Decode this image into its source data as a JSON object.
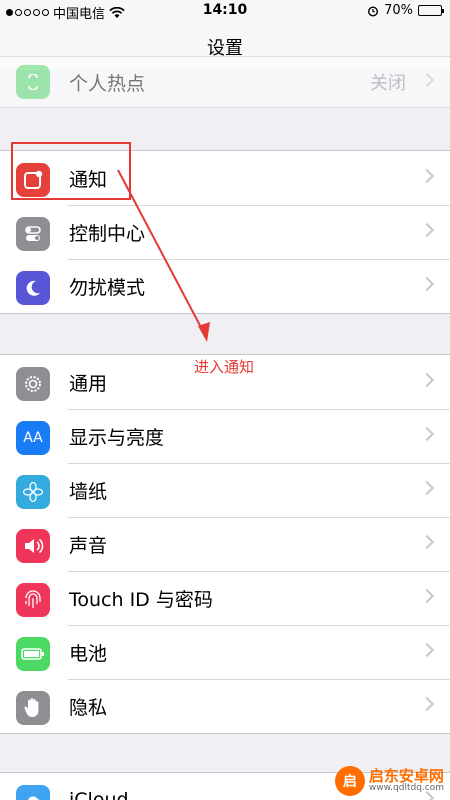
{
  "status_bar": {
    "carrier": "中国电信",
    "time": "14:10",
    "battery": "70%",
    "battery_level": 0.7
  },
  "nav": {
    "title": "设置"
  },
  "rows": {
    "hotspot": {
      "label": "个人热点",
      "value": "关闭"
    },
    "notifications": {
      "label": "通知"
    },
    "control_center": {
      "label": "控制中心"
    },
    "dnd": {
      "label": "勿扰模式"
    },
    "general": {
      "label": "通用"
    },
    "display": {
      "label": "显示与亮度",
      "icon_text": "AA"
    },
    "wallpaper": {
      "label": "墙纸"
    },
    "sounds": {
      "label": "声音"
    },
    "touchid": {
      "label": "Touch ID 与密码"
    },
    "battery": {
      "label": "电池"
    },
    "privacy": {
      "label": "隐私"
    },
    "icloud": {
      "label": "iCloud"
    }
  },
  "annotation": {
    "text": "进入通知",
    "color": "#e53935"
  },
  "watermark": {
    "name": "启东安卓网",
    "url": "www.qdltdq.com",
    "badge": "启"
  },
  "colors": {
    "notifications": "#e5413a",
    "control_center": "#8e8e93",
    "dnd": "#5856d6",
    "general": "#8e8e93",
    "display": "#1a7cf5",
    "wallpaper": "#35aadc",
    "sounds": "#f0355b",
    "touchid": "#f0355b",
    "battery": "#4cd964",
    "privacy": "#8e8e93",
    "icloud": "#3ea3f0"
  }
}
